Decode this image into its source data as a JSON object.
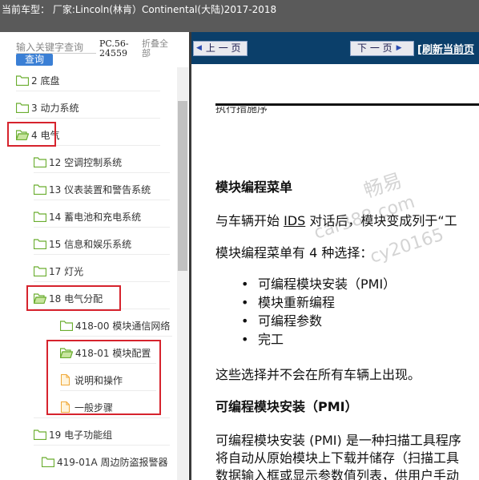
{
  "title_bar": {
    "text": "当前车型： 厂家:Lincoln(林肯）Continental(大陆)2017-2018"
  },
  "search": {
    "placeholder": "输入关键字查询",
    "button_label": "查询"
  },
  "pc_code": "PC.56-24559",
  "collapse_all_label": "折叠全部",
  "tree": [
    {
      "label": "2 底盘",
      "icon": "folder-icon"
    },
    {
      "label": "3 动力系统",
      "icon": "folder-icon"
    },
    {
      "label": "4 电气",
      "icon": "folder-open-icon",
      "highlighted": true
    },
    {
      "label": "12 空调控制系统",
      "icon": "folder-icon"
    },
    {
      "label": "13 仪表装置和警告系统",
      "icon": "folder-icon"
    },
    {
      "label": "14 蓄电池和充电系统",
      "icon": "folder-icon"
    },
    {
      "label": "15 信息和娱乐系统",
      "icon": "folder-icon"
    },
    {
      "label": "17 灯光",
      "icon": "folder-icon"
    },
    {
      "label": "18 电气分配",
      "icon": "folder-open-icon",
      "highlighted": true
    },
    {
      "label": "418-00 模块通信网络",
      "icon": "folder-icon"
    },
    {
      "label": "418-01 模块配置",
      "icon": "folder-open-icon",
      "highlighted": true
    },
    {
      "label": "说明和操作",
      "icon": "document-icon",
      "highlighted": true
    },
    {
      "label": "一般步骤",
      "icon": "document-icon",
      "highlighted": true
    },
    {
      "label": "19 电子功能组",
      "icon": "folder-icon"
    },
    {
      "label": "419-01A 周边防盗报警器",
      "icon": "folder-icon"
    }
  ],
  "nav": {
    "prev_label": "上 一 页",
    "next_label": "下 一 页",
    "refresh_label": "[刷新当前页"
  },
  "document": {
    "cut_heading": "执行措施序",
    "heading_menu": "模块编程菜单",
    "para1_prefix": "与车辆开始 ",
    "para1_ids": "IDS",
    "para1_suffix": " 对话后，模块变成列于“工",
    "para2": "模块编程菜单有 4 种选择：",
    "bullets": [
      "可编程模块安装（PMI）",
      "模块重新编程",
      "可编程参数",
      "完工"
    ],
    "para3": "这些选择并不会在所有车辆上出现。",
    "heading_pmi": "可编程模块安装（PMI）",
    "para4_line1": "可编程模块安装 (PMI) 是一种扫描工具程序",
    "para4_line2": "将自动从原始模块上下载并储存（扫描工具",
    "para4_line3": "数据输入框或显示参数值列表，供用户手动"
  },
  "watermark": {
    "line1": "畅易",
    "line2": "car388.com",
    "line3": "cy20165"
  },
  "colors": {
    "highlight": "#d6232d",
    "nav_bg": "#0b3f6a",
    "folder": "#7dbb3c",
    "document": "#f2b24a",
    "query_button": "#3a7fd5"
  }
}
